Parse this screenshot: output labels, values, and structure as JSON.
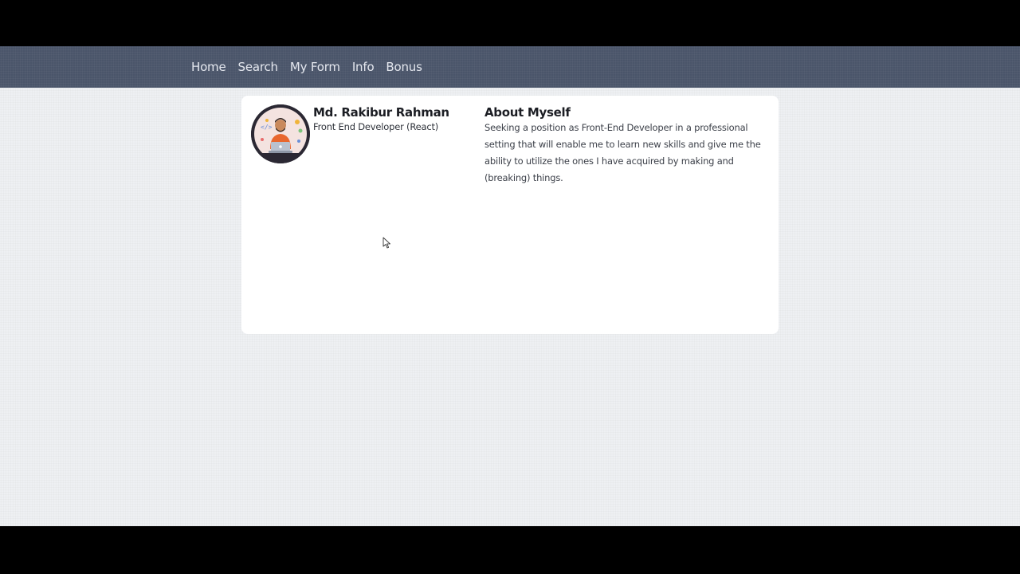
{
  "nav": {
    "links": [
      {
        "label": "Home"
      },
      {
        "label": "Search"
      },
      {
        "label": "My Form"
      },
      {
        "label": "Info"
      },
      {
        "label": "Bonus"
      }
    ]
  },
  "profile": {
    "avatar_icon": "developer-avatar-illustration",
    "name": "Md. Rakibur Rahman",
    "role": "Front End Developer (React)"
  },
  "about": {
    "title": "About Myself",
    "text": "Seeking a position as Front-End Developer in a professional setting that will enable me to learn new skills and give me the ability to utilize the ones I have acquired by making and (breaking) things."
  },
  "colors": {
    "navbar": "#4a556a",
    "page_background": "#eef0f3",
    "card": "#ffffff",
    "nav_text": "#e4e7ee"
  }
}
